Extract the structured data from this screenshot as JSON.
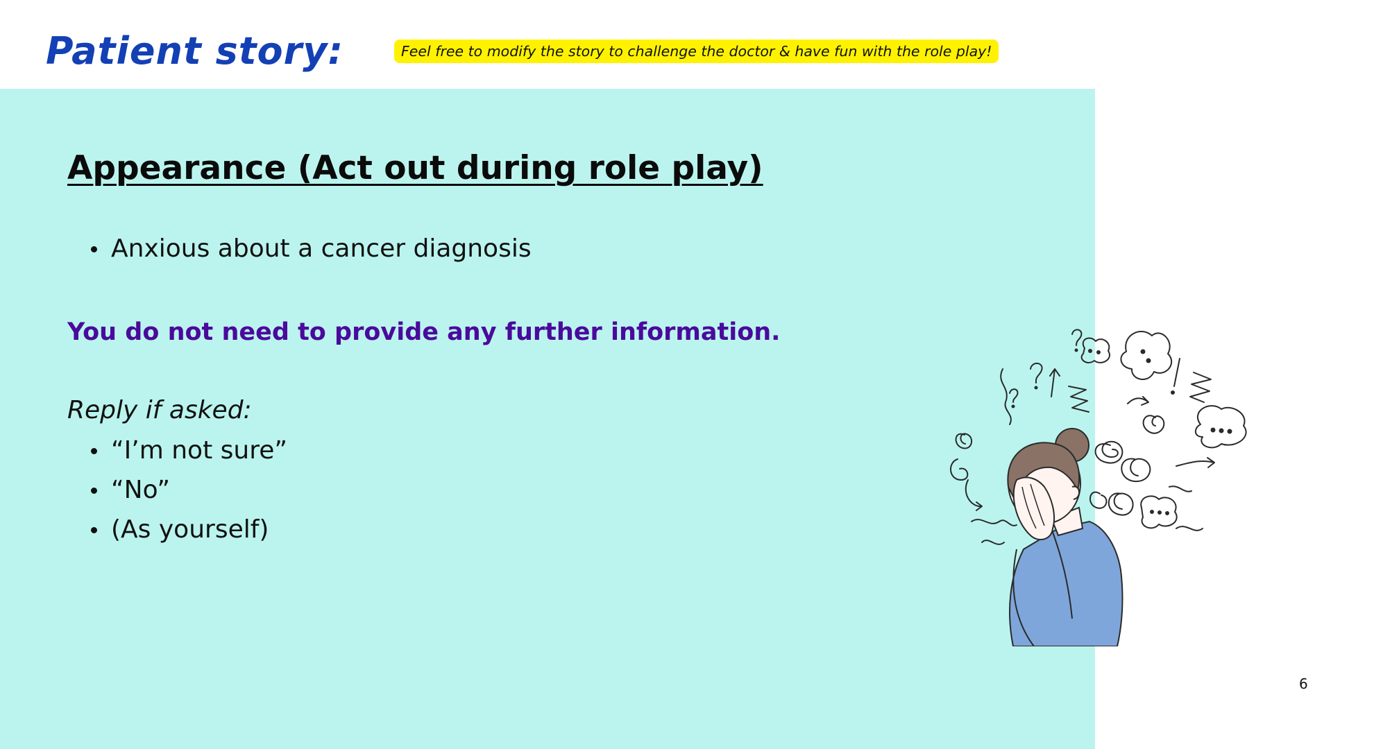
{
  "slide": {
    "title": "Patient story:",
    "note": "Feel free to modify the story to challenge the doctor & have fun with the role play!",
    "heading": "Appearance (Act out during role play)",
    "appearance_items": [
      "Anxious about a cancer diagnosis"
    ],
    "instruction": "You do not need to provide any further information.",
    "reply_label": "Reply if asked:",
    "reply_items": [
      "“I’m not sure”",
      "“No”",
      "(As yourself)"
    ],
    "page_number": "6"
  },
  "illustration": {
    "icon": "anxious-woman-illustration"
  },
  "colors": {
    "title": "#1340b4",
    "note_highlight": "#fff200",
    "panel_background": "#bbf4ee",
    "instruction": "#4a0a9c",
    "shirt": "#7fa6da",
    "hair": "#8a7366"
  }
}
